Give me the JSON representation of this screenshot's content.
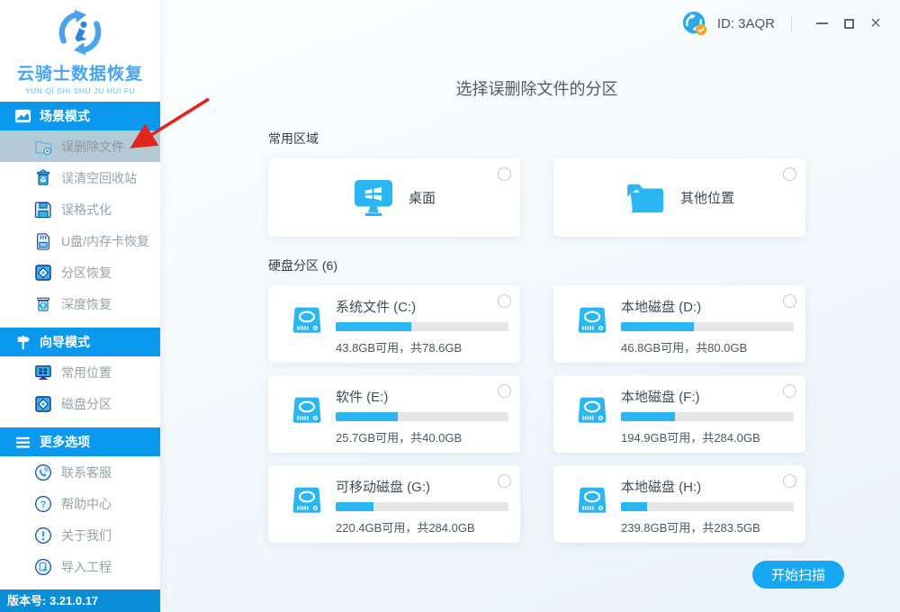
{
  "window": {
    "id_label": "ID: 3AQR"
  },
  "logo": {
    "title": "云骑士数据恢复",
    "subtitle": "YUN QI SHI SHU JU HUI FU"
  },
  "sidebar": {
    "sections": [
      {
        "header": "场景模式",
        "icon": "scene-mode-icon",
        "items": [
          {
            "label": "误删除文件",
            "icon": "deleted-file-icon",
            "selected": true
          },
          {
            "label": "误清空回收站",
            "icon": "recycle-bin-icon",
            "selected": false
          },
          {
            "label": "误格式化",
            "icon": "format-icon",
            "selected": false
          },
          {
            "label": "U盘/内存卡恢复",
            "icon": "sd-card-icon",
            "selected": false
          },
          {
            "label": "分区恢复",
            "icon": "partition-recovery-icon",
            "selected": false
          },
          {
            "label": "深度恢复",
            "icon": "deep-recovery-icon",
            "selected": false
          }
        ]
      },
      {
        "header": "向导模式",
        "icon": "wizard-mode-icon",
        "items": [
          {
            "label": "常用位置",
            "icon": "monitor-icon",
            "selected": false
          },
          {
            "label": "磁盘分区",
            "icon": "disk-partition-icon",
            "selected": false
          }
        ]
      },
      {
        "header": "更多选项",
        "icon": "menu-icon",
        "items": [
          {
            "label": "联系客服",
            "icon": "phone-icon",
            "selected": false
          },
          {
            "label": "帮助中心",
            "icon": "question-icon",
            "selected": false
          },
          {
            "label": "关于我们",
            "icon": "exclamation-icon",
            "selected": false
          },
          {
            "label": "导入工程",
            "icon": "import-icon",
            "selected": false
          }
        ]
      }
    ],
    "version_label": "版本号: 3.21.0.17"
  },
  "main": {
    "title": "选择误删除文件的分区",
    "common_label": "常用区域",
    "partitions_label": "硬盘分区 (6)",
    "common_items": [
      {
        "label": "桌面",
        "icon": "desktop-icon"
      },
      {
        "label": "其他位置",
        "icon": "open-folder-icon"
      }
    ],
    "partitions": [
      {
        "name": "系统文件 (C:)",
        "detail": "43.8GB可用，共78.6GB",
        "used_percent": 44
      },
      {
        "name": "本地磁盘 (D:)",
        "detail": "46.8GB可用，共80.0GB",
        "used_percent": 42
      },
      {
        "name": "软件 (E:)",
        "detail": "25.7GB可用，共40.0GB",
        "used_percent": 36
      },
      {
        "name": "本地磁盘 (F:)",
        "detail": "194.9GB可用，共284.0GB",
        "used_percent": 31
      },
      {
        "name": "可移动磁盘 (G:)",
        "detail": "220.4GB可用，共284.0GB",
        "used_percent": 22
      },
      {
        "name": "本地磁盘 (H:)",
        "detail": "239.8GB可用，共283.5GB",
        "used_percent": 15
      }
    ],
    "scan_button_label": "开始扫描"
  },
  "colors": {
    "accent_blue": "#0a99ef",
    "cyan": "#29b6f2",
    "version_bar_blue": "#0a8ed8",
    "selected_item_bg": "#b5cad7",
    "annotation_red": "#e0261d"
  }
}
